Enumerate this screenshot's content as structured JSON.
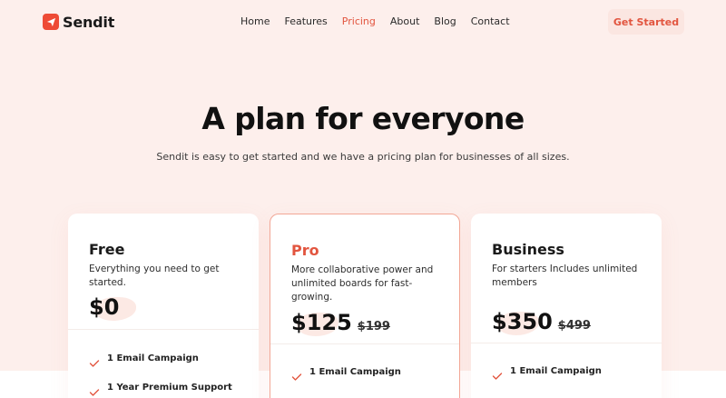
{
  "brand": {
    "name": "Sendit",
    "logo_icon": "paper-plane-icon",
    "accent": "#ee4b36"
  },
  "nav": {
    "items": [
      {
        "label": "Home"
      },
      {
        "label": "Features"
      },
      {
        "label": "Pricing",
        "active": true
      },
      {
        "label": "About"
      },
      {
        "label": "Blog"
      },
      {
        "label": "Contact"
      }
    ],
    "cta_label": "Get Started"
  },
  "hero": {
    "title": "A plan for everyone",
    "subtitle": "Sendit is easy to get started and we have a pricing plan for businesses of all sizes."
  },
  "plans": [
    {
      "name": "Free",
      "description": "Everything you need to get started.",
      "price": "$0",
      "old_price": "",
      "features": [
        "1 Email Campaign",
        "1 Year Premium Support"
      ]
    },
    {
      "name": "Pro",
      "description": "More collaborative power and unlimited boards for fast-growing.",
      "price": "$125",
      "old_price": "$199",
      "featured": true,
      "features": [
        "1 Email Campaign"
      ]
    },
    {
      "name": "Business",
      "description": "For starters Includes unlimited members",
      "price": "$350",
      "old_price": "$499",
      "features": [
        "1 Email Campaign"
      ]
    }
  ],
  "colors": {
    "background": "#fdefec",
    "accent_text": "#e2553f",
    "check": "#e2553f"
  },
  "icons": {
    "feature_check": "check-icon"
  }
}
